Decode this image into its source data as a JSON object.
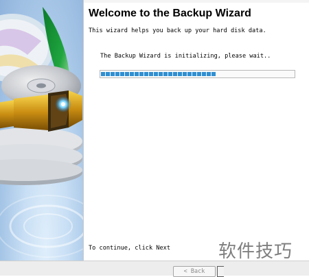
{
  "wizard": {
    "title": "Welcome to the Backup Wizard",
    "subtitle": "This wizard helps you back up your hard disk data.",
    "status_text": "The Backup Wizard is initializing, please wait..",
    "progress": 0.59,
    "continue_text": "To continue, click Next"
  },
  "buttons": {
    "back_label": "< Back"
  },
  "watermark": {
    "text": "软件技巧"
  },
  "colors": {
    "progress": "#2f8fd1",
    "title": "#000000",
    "banner": "#a9c8e8"
  }
}
